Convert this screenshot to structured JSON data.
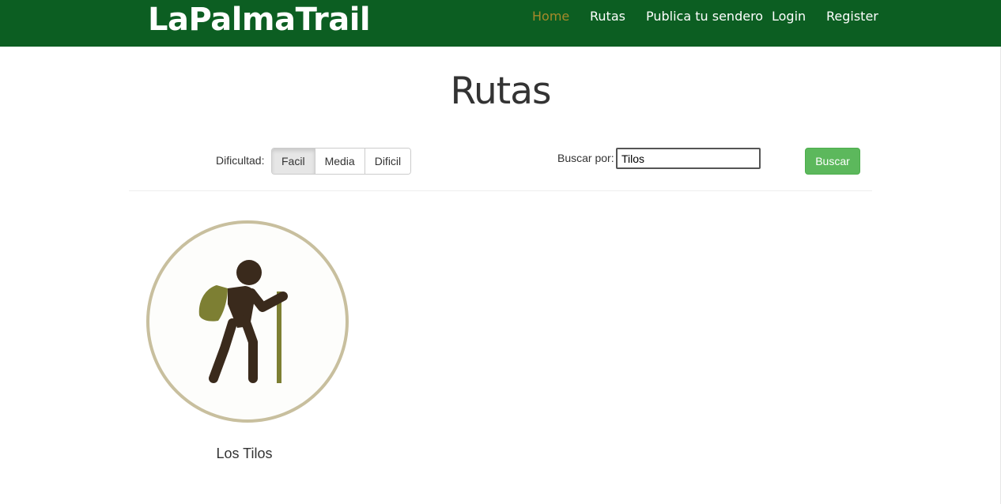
{
  "navbar": {
    "brand": "LaPalmaTrail",
    "links": [
      {
        "label": "Home",
        "active": true
      },
      {
        "label": "Rutas",
        "active": false
      },
      {
        "label": "Publica tu sendero",
        "active": false
      },
      {
        "label": "Login",
        "active": false
      },
      {
        "label": "Register",
        "active": false
      }
    ]
  },
  "page": {
    "title": "Rutas"
  },
  "filters": {
    "difficulty_label": "Dificultad:",
    "options": [
      {
        "label": "Facil",
        "selected": true
      },
      {
        "label": "Media",
        "selected": false
      },
      {
        "label": "Dificil",
        "selected": false
      }
    ],
    "search_label": "Buscar por:",
    "search_value": "Tilos",
    "search_button": "Buscar"
  },
  "results": [
    {
      "title": "Los Tilos",
      "icon": "hiker-icon"
    }
  ],
  "colors": {
    "navbar": "#0c5e22",
    "active_link": "#a6892a",
    "search_button": "#5cb85c",
    "hiker_body": "#3a2a1c",
    "backpack": "#7d7f33",
    "circle_border": "#c8bf9e"
  }
}
